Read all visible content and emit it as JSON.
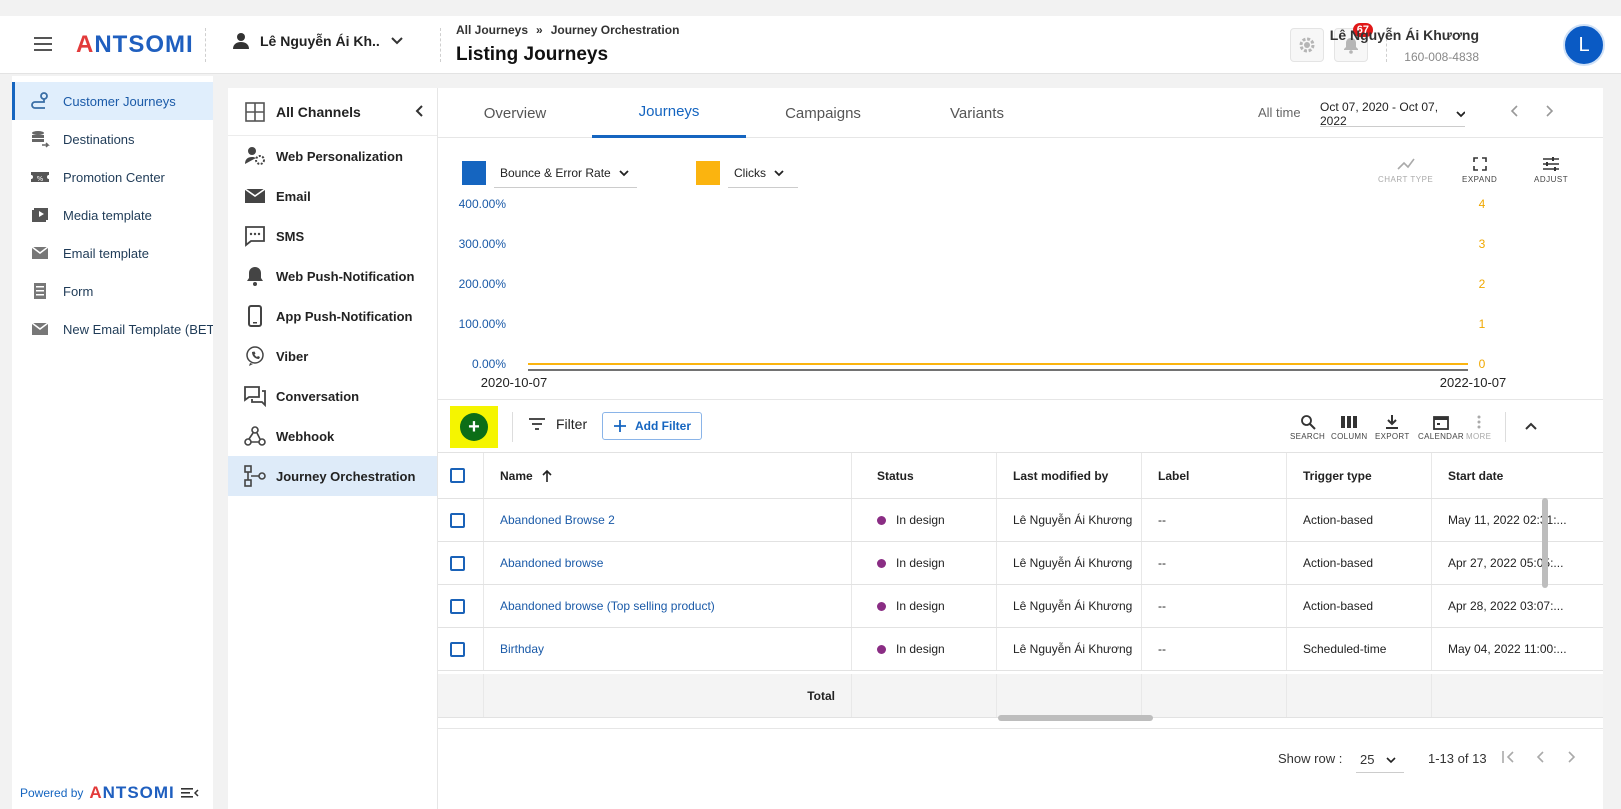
{
  "header": {
    "logo_text": "ANTSOMI",
    "portal_name": "Lê Nguyễn Ái Kh...",
    "breadcrumb": [
      "All Journeys",
      "Journey Orchestration"
    ],
    "breadcrumb_sep": "»",
    "page_title": "Listing Journeys",
    "notification_count": "67",
    "user_name": "Lê Nguyễn Ái Khương",
    "user_id": "160-008-4838",
    "avatar_letter": "L"
  },
  "sidebar": {
    "items": [
      {
        "label": "Customer Journeys",
        "icon": "journey-icon",
        "active": true
      },
      {
        "label": "Destinations",
        "icon": "database-icon"
      },
      {
        "label": "Promotion Center",
        "icon": "ticket-icon"
      },
      {
        "label": "Media template",
        "icon": "media-icon"
      },
      {
        "label": "Email template",
        "icon": "mail-icon"
      },
      {
        "label": "Form",
        "icon": "form-icon"
      },
      {
        "label": "New Email Template (BETA)",
        "icon": "mail-icon"
      }
    ],
    "powered_by": "Powered by",
    "powered_logo": "ANTSOMI"
  },
  "channels": {
    "title": "All Channels",
    "items": [
      {
        "label": "Web Personalization",
        "icon": "web-personalization-icon"
      },
      {
        "label": "Email",
        "icon": "email-icon"
      },
      {
        "label": "SMS",
        "icon": "sms-icon"
      },
      {
        "label": "Web Push-Notification",
        "icon": "bell-icon"
      },
      {
        "label": "App Push-Notification",
        "icon": "phone-icon"
      },
      {
        "label": "Viber",
        "icon": "viber-icon"
      },
      {
        "label": "Conversation",
        "icon": "conversation-icon"
      },
      {
        "label": "Webhook",
        "icon": "webhook-icon"
      },
      {
        "label": "Journey Orchestration",
        "icon": "orchestration-icon",
        "active": true
      }
    ]
  },
  "tabs": [
    "Overview",
    "Journeys",
    "Campaigns",
    "Variants"
  ],
  "active_tab": "Journeys",
  "date_filter": {
    "label": "All time",
    "range": "Oct 07, 2020 - Oct 07, 2022"
  },
  "metrics": {
    "primary": {
      "label": "Bounce & Error Rate",
      "color": "#1565c0"
    },
    "secondary": {
      "label": "Clicks",
      "color": "#fbb40f"
    }
  },
  "chart_tools": {
    "chart_type": "CHART TYPE",
    "expand": "EXPAND",
    "adjust": "ADJUST"
  },
  "chart_data": {
    "type": "line",
    "x": [
      "2020-10-07",
      "2022-10-07"
    ],
    "x_tick_labels": [
      "2020-10-07",
      "2022-10-07"
    ],
    "y_left_ticks": [
      "0.00%",
      "100.00%",
      "200.00%",
      "300.00%",
      "400.00%"
    ],
    "y_right_ticks": [
      "0",
      "1",
      "2",
      "3",
      "4"
    ],
    "y_left_range": [
      0,
      400
    ],
    "y_right_range": [
      0,
      4
    ],
    "series": [
      {
        "name": "Bounce & Error Rate",
        "axis": "left",
        "color": "#1565c0",
        "values": [
          0,
          0
        ]
      },
      {
        "name": "Clicks",
        "axis": "right",
        "color": "#fbb40f",
        "values": [
          0,
          0
        ]
      }
    ]
  },
  "toolbar": {
    "filter_label": "Filter",
    "add_filter_label": "Add Filter",
    "tools": [
      "SEARCH",
      "COLUMN",
      "EXPORT",
      "CALENDAR",
      "MORE"
    ]
  },
  "table": {
    "columns": [
      "Name",
      "Status",
      "Last modified by",
      "Label",
      "Trigger type",
      "Start date"
    ],
    "rows": [
      {
        "name": "Abandoned Browse 2",
        "status": "In design",
        "modified_by": "Lê Nguyễn Ái Khương",
        "label": "--",
        "trigger": "Action-based",
        "start": "May 11, 2022 02:31:..."
      },
      {
        "name": "Abandoned browse",
        "status": "In design",
        "modified_by": "Lê Nguyễn Ái Khương",
        "label": "--",
        "trigger": "Action-based",
        "start": "Apr 27, 2022 05:05:..."
      },
      {
        "name": "Abandoned browse (Top selling product)",
        "status": "In design",
        "modified_by": "Lê Nguyễn Ái Khương",
        "label": "--",
        "trigger": "Action-based",
        "start": "Apr 28, 2022 03:07:..."
      },
      {
        "name": "Birthday",
        "status": "In design",
        "modified_by": "Lê Nguyễn Ái Khương",
        "label": "--",
        "trigger": "Scheduled-time",
        "start": "May 04, 2022 11:00:..."
      }
    ],
    "total_label": "Total",
    "status_color": "#8a2d84"
  },
  "pagination": {
    "show_row_label": "Show row :",
    "rows_per_page": "25",
    "range": "1-13 of 13"
  }
}
